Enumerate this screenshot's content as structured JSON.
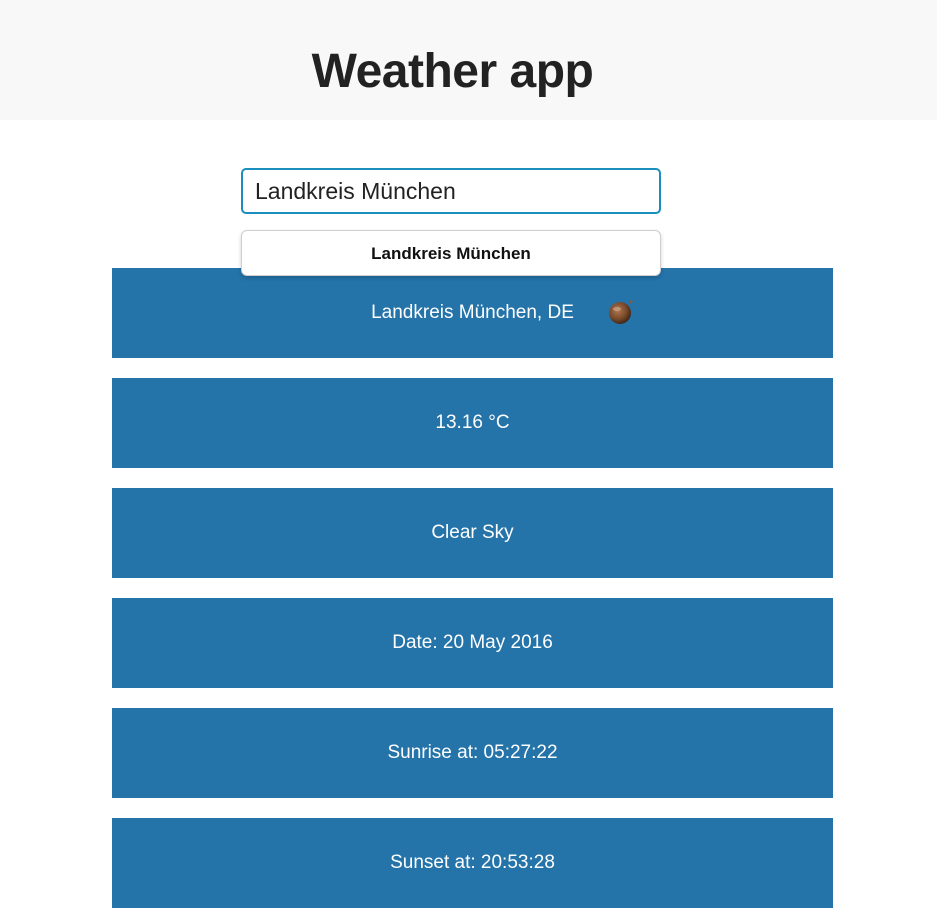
{
  "header": {
    "title": "Weather app"
  },
  "search": {
    "value": "Landkreis München",
    "suggestions": [
      "Landkreis München"
    ]
  },
  "weather": {
    "location": "Landkreis München, DE",
    "temperature": "13.16 °C",
    "condition": "Clear Sky",
    "date": "Date: 20 May 2016",
    "sunrise": "Sunrise at: 05:27:22",
    "sunset": "Sunset at: 20:53:28",
    "icon": "clear-night-moon-icon"
  },
  "colors": {
    "card_background": "#2473a9",
    "input_border": "#1a8ebc",
    "header_background": "#f8f8f8"
  }
}
